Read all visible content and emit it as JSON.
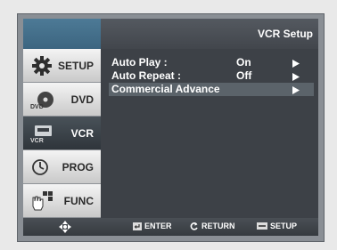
{
  "header": {
    "title": "VCR Setup"
  },
  "sidebar": {
    "items": [
      {
        "label": "SETUP",
        "icon": "gear-icon"
      },
      {
        "label": "DVD",
        "icon": "dvd-icon",
        "icon_text": "DVD"
      },
      {
        "label": "VCR",
        "icon": "vcr-icon",
        "icon_text": "VCR",
        "active": true
      },
      {
        "label": "PROG",
        "icon": "clock-icon"
      },
      {
        "label": "FUNC",
        "icon": "hand-icon"
      }
    ]
  },
  "menu": {
    "rows": [
      {
        "label": "Auto Play :",
        "value": "On",
        "arrow": "▶"
      },
      {
        "label": "Auto Repeat :",
        "value": "Off",
        "arrow": "▶"
      },
      {
        "label": "Commercial Advance",
        "value": "",
        "arrow": "▶",
        "selected": true
      }
    ]
  },
  "footer": {
    "nav_icon": "dpad-icon",
    "enter": "ENTER",
    "return": "RETURN",
    "setup": "SETUP"
  },
  "colors": {
    "screen_bg": "#3d4147",
    "selected_row": "#5b636a",
    "header_accent": "#4d7a96"
  }
}
